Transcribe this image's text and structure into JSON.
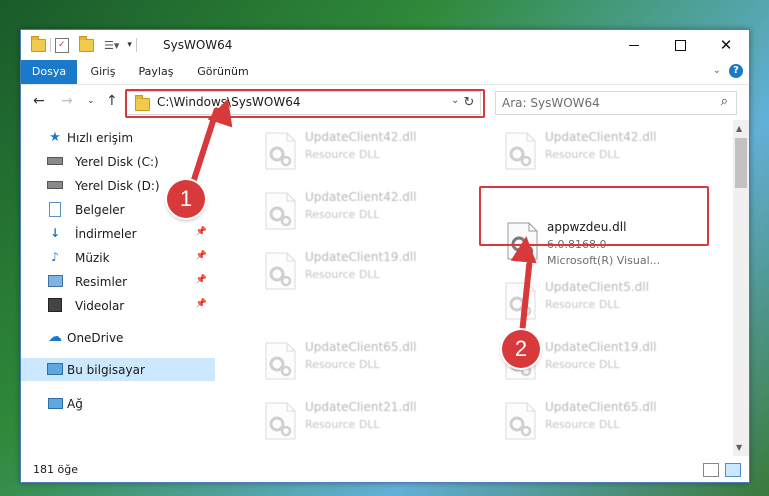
{
  "window": {
    "title": "SysWOW64"
  },
  "ribbon": {
    "tabs": [
      "Dosya",
      "Giriş",
      "Paylaş",
      "Görünüm"
    ],
    "help": "?"
  },
  "nav": {
    "address": "C:\\Windows\\SysWOW64",
    "search_placeholder": "Ara: SysWOW64"
  },
  "sidebar": {
    "items": [
      {
        "label": "Hızlı erişim",
        "icon": "star-icon"
      },
      {
        "label": "Yerel Disk (C:)",
        "icon": "drive-icon"
      },
      {
        "label": "Yerel Disk (D:)",
        "icon": "drive-icon"
      },
      {
        "label": "Belgeler",
        "icon": "documents-icon"
      },
      {
        "label": "İndirmeler",
        "icon": "download-icon"
      },
      {
        "label": "Müzik",
        "icon": "music-icon"
      },
      {
        "label": "Resimler",
        "icon": "pictures-icon"
      },
      {
        "label": "Videolar",
        "icon": "video-icon"
      },
      {
        "label": "OneDrive",
        "icon": "cloud-icon"
      },
      {
        "label": "Bu bilgisayar",
        "icon": "computer-icon"
      },
      {
        "label": "Ağ",
        "icon": "network-icon"
      }
    ]
  },
  "files": [
    {
      "name": "UpdateClient42.dll",
      "desc": "Resource DLL"
    },
    {
      "name": "UpdateClient42.dll",
      "desc": "Resource DLL"
    },
    {
      "name": "UpdateClient42.dll",
      "desc": "Resource DLL"
    },
    {
      "name": "appwzdeu.dll",
      "desc": "6.0.8168.0",
      "desc2": "Microsoft(R) Visual..."
    },
    {
      "name": "UpdateClient19.dll",
      "desc": "Resource DLL"
    },
    {
      "name": "UpdateClient5.dll",
      "desc": "Resource DLL"
    },
    {
      "name": "UpdateClient65.dll",
      "desc": "Resource DLL"
    },
    {
      "name": "UpdateClient19.dll",
      "desc": "Resource DLL"
    },
    {
      "name": "UpdateClient21.dll",
      "desc": "Resource DLL"
    },
    {
      "name": "UpdateClient65.dll",
      "desc": "Resource DLL"
    }
  ],
  "status": {
    "count": "181 öğe"
  },
  "annotations": {
    "step1": "1",
    "step2": "2"
  },
  "colors": {
    "accent": "#1979ca",
    "highlight": "#d8393a",
    "selected": "#cce8ff"
  }
}
